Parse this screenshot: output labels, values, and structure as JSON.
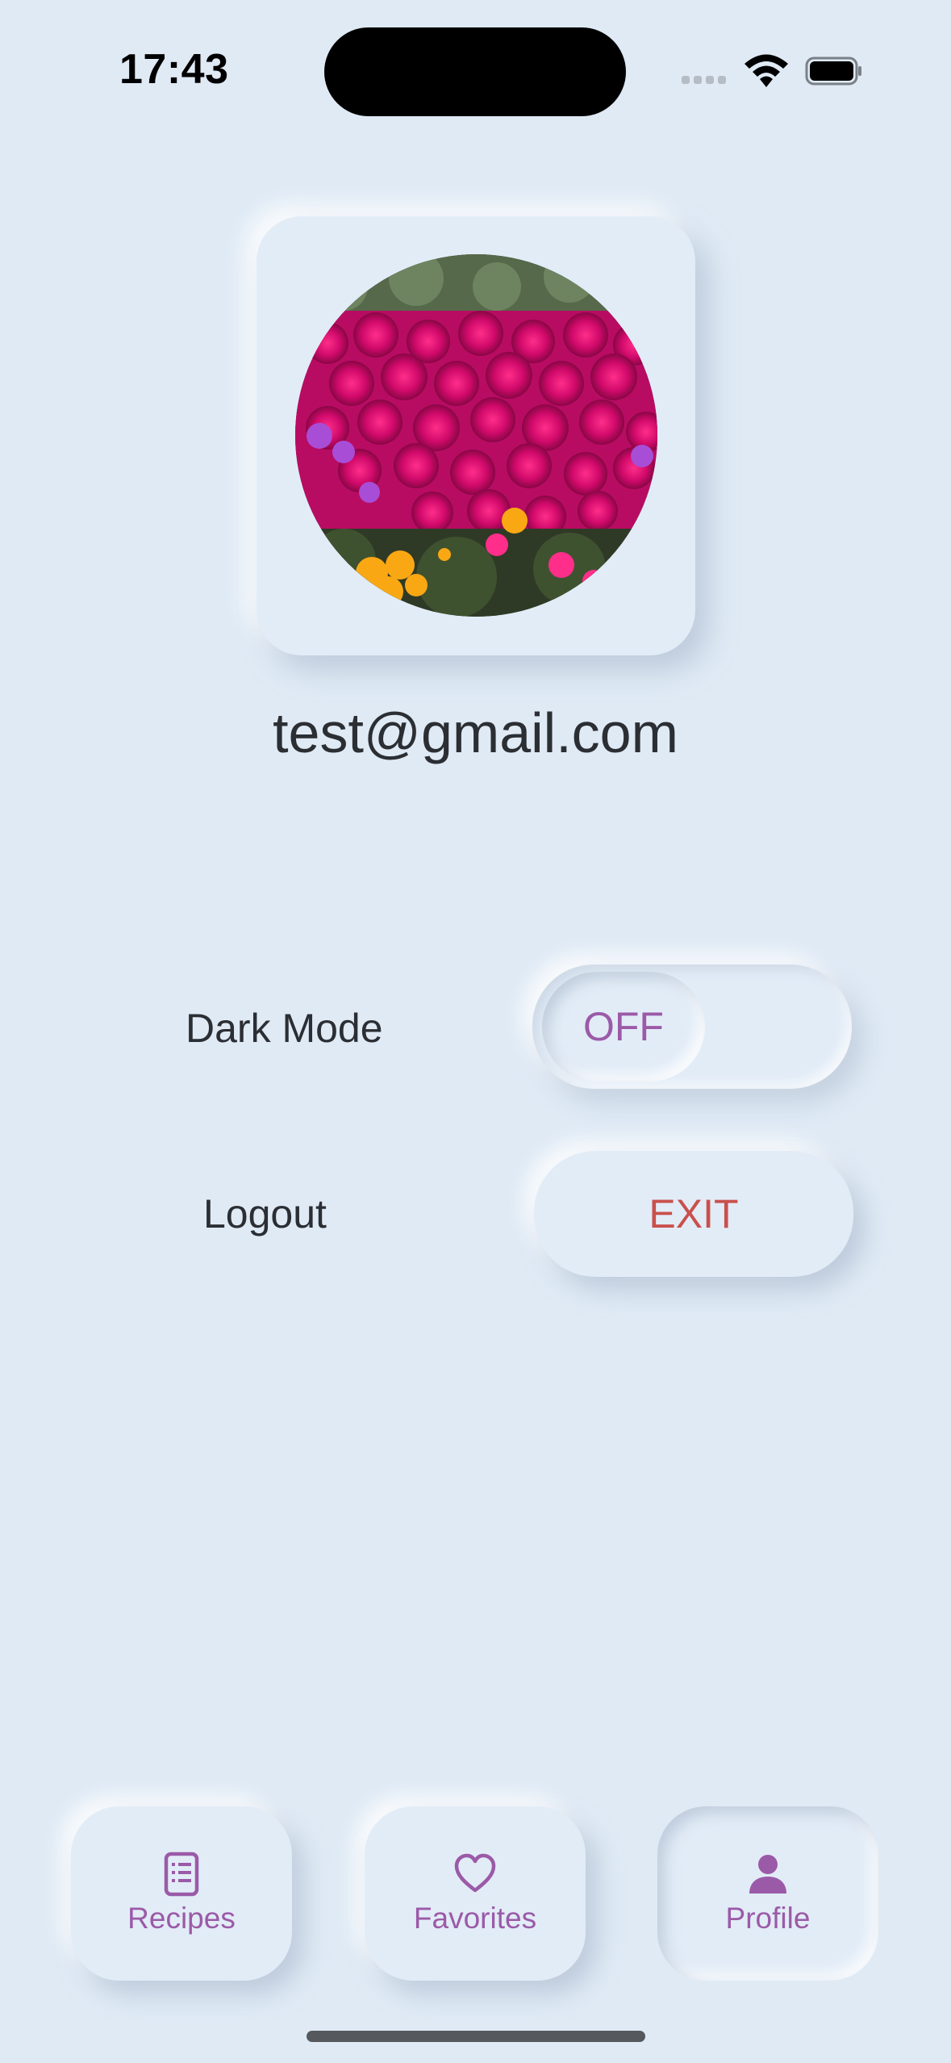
{
  "status_bar": {
    "time": "17:43"
  },
  "profile": {
    "email": "test@gmail.com",
    "avatar_icon": "flower-photo"
  },
  "settings": {
    "dark_mode": {
      "label": "Dark Mode",
      "state": "OFF"
    },
    "logout": {
      "label": "Logout",
      "button": "EXIT"
    }
  },
  "nav": {
    "items": [
      {
        "label": "Recipes",
        "icon": "recipe-book-icon"
      },
      {
        "label": "Favorites",
        "icon": "heart-icon"
      },
      {
        "label": "Profile",
        "icon": "person-icon",
        "active": true
      }
    ]
  },
  "colors": {
    "background": "#dfeaf5",
    "accent": "#9b5aa8",
    "danger": "#c9504c",
    "text": "#2b2e33"
  }
}
